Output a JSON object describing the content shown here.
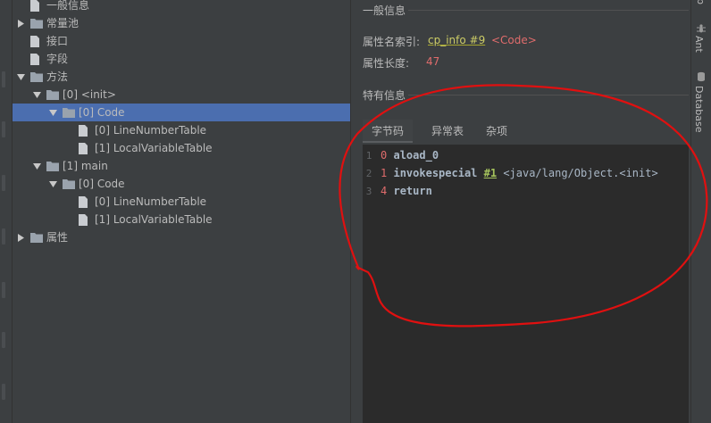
{
  "tree": {
    "nodes": [
      {
        "label": "一般信息",
        "type": "file"
      },
      {
        "label": "常量池",
        "type": "folder",
        "expanded": false
      },
      {
        "label": "接口",
        "type": "file"
      },
      {
        "label": "字段",
        "type": "file"
      },
      {
        "label": "方法",
        "type": "folder",
        "expanded": true
      },
      {
        "label": "[0] <init>",
        "type": "folder",
        "expanded": true
      },
      {
        "label": "[0] Code",
        "type": "folder",
        "expanded": true,
        "selected": true
      },
      {
        "label": "[0] LineNumberTable",
        "type": "file"
      },
      {
        "label": "[1] LocalVariableTable",
        "type": "file"
      },
      {
        "label": "[1] main",
        "type": "folder",
        "expanded": true
      },
      {
        "label": "[0] Code",
        "type": "folder",
        "expanded": true
      },
      {
        "label": "[0] LineNumberTable",
        "type": "file"
      },
      {
        "label": "[1] LocalVariableTable",
        "type": "file"
      },
      {
        "label": "属性",
        "type": "folder",
        "expanded": false
      }
    ]
  },
  "general": {
    "title": "一般信息",
    "name_index_label": "属性名索引:",
    "name_index_link": "cp_info #9",
    "name_index_value": "<Code>",
    "length_label": "属性长度:",
    "length_value": "47"
  },
  "specific": {
    "title": "特有信息",
    "tabs": [
      "字节码",
      "异常表",
      "杂项"
    ],
    "active_tab": 0
  },
  "bytecode": {
    "lines": [
      {
        "num": "1",
        "offset": "0",
        "op": "aload_0",
        "ref": "",
        "comment": ""
      },
      {
        "num": "2",
        "offset": "1",
        "op": "invokespecial",
        "ref": "#1",
        "comment": "<java/lang/Object.<init>"
      },
      {
        "num": "3",
        "offset": "4",
        "op": "return",
        "ref": "",
        "comment": ""
      }
    ]
  },
  "toolstrip": {
    "top_label": "b",
    "ant_label": "Ant",
    "database_label": "Database"
  },
  "colors": {
    "selection": "#4b6eaf",
    "annotation": "#e01010",
    "link": "#cccc66",
    "value_red": "#e06c6c"
  }
}
